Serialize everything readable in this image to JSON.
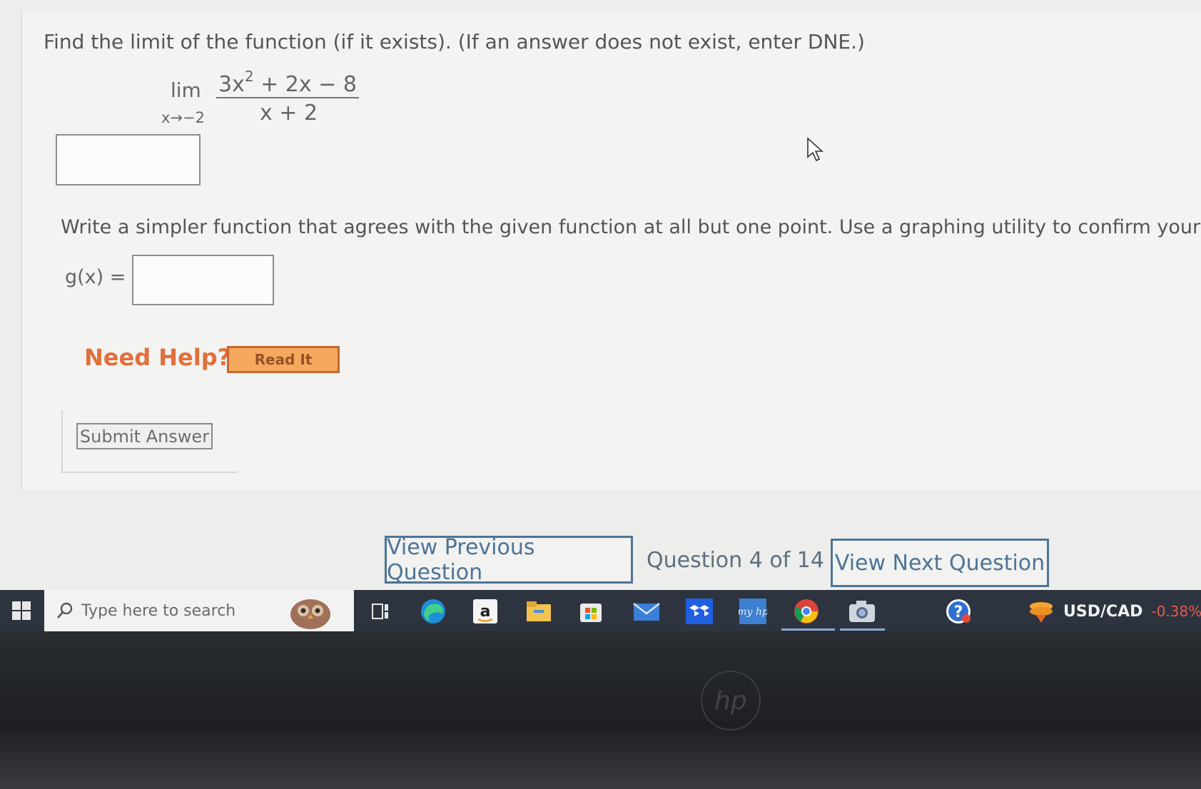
{
  "question": {
    "prompt": "Find the limit of the function (if it exists). (If an answer does not exist, enter DNE.)",
    "lim_word": "lim",
    "lim_subscript": "x→−2",
    "numerator_lead": "3x",
    "numerator_exponent": "2",
    "numerator_rest": " + 2x − 8",
    "denominator": "x + 2",
    "limit_answer_value": "",
    "prompt2": "Write a simpler function that agrees with the given function at all but one point. Use a graphing utility to confirm your re",
    "g_label": "g(x) =",
    "g_answer_value": ""
  },
  "help": {
    "label": "Need Help?",
    "read_it": "Read It"
  },
  "submit": {
    "label": "Submit Answer"
  },
  "navigation": {
    "previous": "View Previous Question",
    "position": "Question 4 of 14",
    "next": "View Next Question"
  },
  "taskbar": {
    "search_placeholder": "Type here to search",
    "icons": [
      "windows-start-icon",
      "task-view-icon",
      "edge-icon",
      "amazon-icon",
      "file-explorer-icon",
      "store-icon",
      "mail-icon",
      "dropbox-icon",
      "myhp-icon",
      "chrome-icon",
      "camera-icon",
      "help-icon"
    ],
    "ticker_label": "USD/CAD",
    "ticker_change": "-0.38%"
  },
  "colors": {
    "help_orange": "#e26f3a",
    "nav_blue": "#4d7496",
    "taskbar_bg": "#2d3440",
    "ticker_negative": "#e25c4d"
  }
}
